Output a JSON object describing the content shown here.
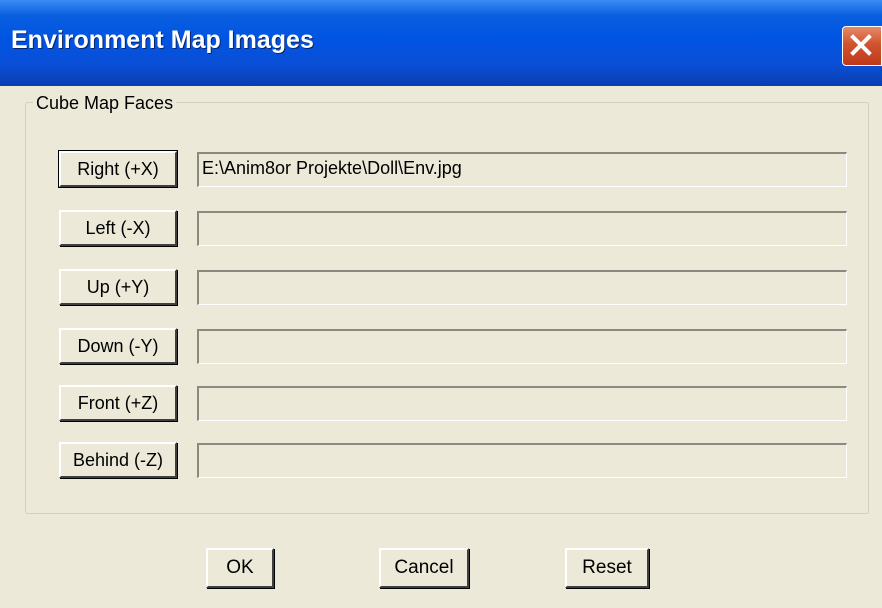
{
  "window": {
    "title": "Environment Map Images",
    "close_icon": "close-icon"
  },
  "group": {
    "label": "Cube Map Faces"
  },
  "faces": [
    {
      "button_label": "Right (+X)",
      "path": "E:\\Anim8or Projekte\\Doll\\Env.jpg"
    },
    {
      "button_label": "Left (-X)",
      "path": ""
    },
    {
      "button_label": "Up (+Y)",
      "path": ""
    },
    {
      "button_label": "Down (-Y)",
      "path": ""
    },
    {
      "button_label": "Front (+Z)",
      "path": ""
    },
    {
      "button_label": "Behind (-Z)",
      "path": ""
    }
  ],
  "buttons": {
    "ok": "OK",
    "cancel": "Cancel",
    "reset": "Reset"
  },
  "colors": {
    "titlebar": "#0054e3",
    "close_button": "#c0391a",
    "dialog_bg": "#ece9d8"
  }
}
